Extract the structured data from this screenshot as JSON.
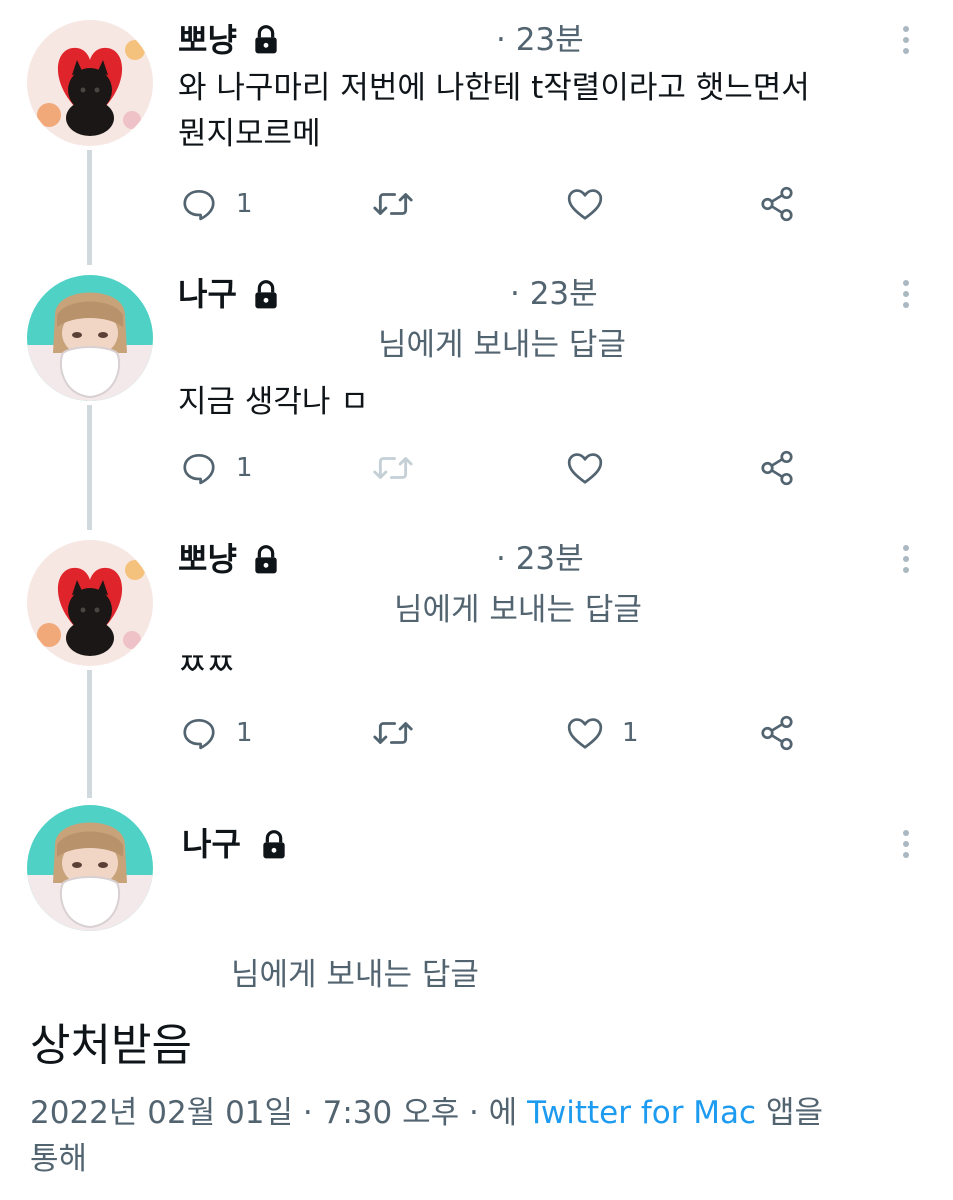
{
  "tweets": [
    {
      "name": "뽀냥",
      "time": "· 23분",
      "reply_to": "",
      "text_lines": [
        "와 나구마리 저번에 나한테 t작렬이라고 햇느면서",
        "뭔지모르메"
      ],
      "reply_count": "1",
      "like_count": ""
    },
    {
      "name": "나구",
      "time": "· 23분",
      "reply_to": "님에게 보내는 답글",
      "text_lines": [
        "지금 생각나 ㅁ"
      ],
      "reply_count": "1",
      "like_count": ""
    },
    {
      "name": "뽀냥",
      "time": "· 23분",
      "reply_to": "님에게 보내는 답글",
      "text_lines": [
        "ㅉㅉ"
      ],
      "reply_count": "1",
      "like_count": "1"
    },
    {
      "name": "나구",
      "reply_to": "님에게 보내는 답글",
      "text": "상처받음",
      "meta_prefix": "2022년 02월 01일 · 7:30 오후 · 에 ",
      "meta_link": "Twitter for Mac",
      "meta_suffix": " 앱을",
      "meta_line2": "통해"
    }
  ],
  "icons": {
    "reply": "reply-icon",
    "retweet": "retweet-icon",
    "like": "heart-icon",
    "share": "share-icon",
    "more": "more-options-icon",
    "lock": "lock-icon"
  },
  "colors": {
    "text": "#0f1419",
    "secondary": "#536471",
    "link": "#1d9bf0",
    "thread_line": "#cfd9de"
  }
}
